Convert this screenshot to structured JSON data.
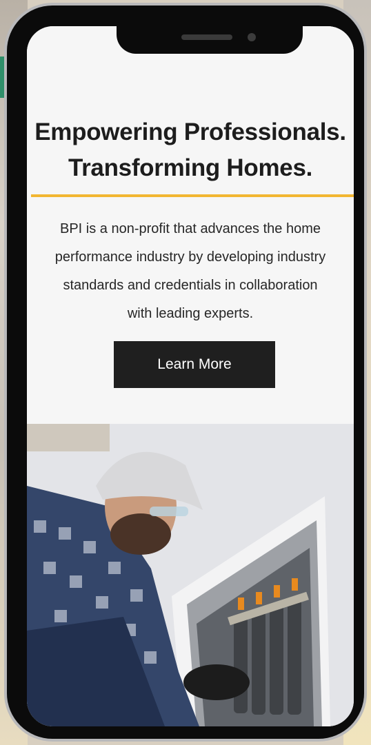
{
  "hero": {
    "headline_line1": "Empowering Professionals.",
    "headline_line2": "Transforming Homes.",
    "desc_line1": "BPI is a non-profit that advances the home",
    "desc_line2": "performance industry by developing industry",
    "desc_line3": "standards and credentials in collaboration",
    "desc_line4": "with leading experts.",
    "button_label": "Learn More",
    "accent_color": "#f2b632"
  },
  "photo": {
    "icon": "technician-photo"
  }
}
